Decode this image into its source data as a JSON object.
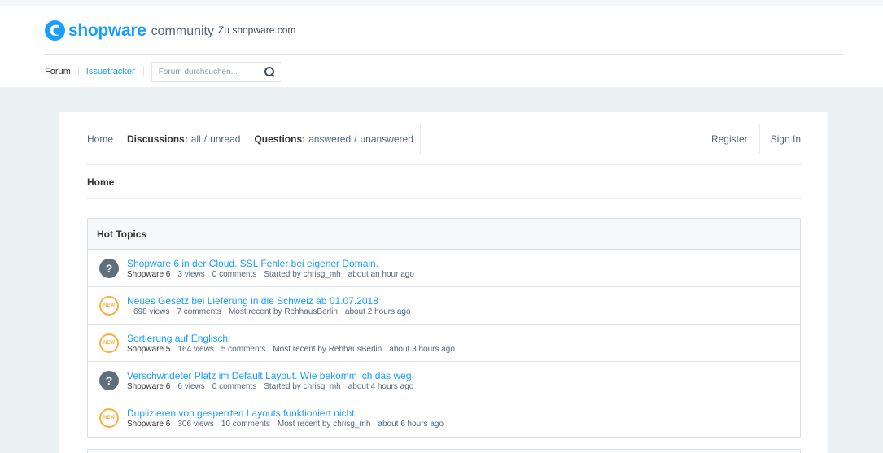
{
  "brand": {
    "logo_word": "shopware",
    "logo_sub": "community",
    "zu_link": "Zu shopware.com",
    "accent": "#189eff"
  },
  "subnav": {
    "forum": "Forum",
    "issuetracker": "Issuetracker",
    "search_placeholder": "Forum durchsuchen..."
  },
  "mainnav": {
    "home": "Home",
    "discussions_label": "Discussions:",
    "discussions_all": "all",
    "discussions_unread": "unread",
    "questions_label": "Questions:",
    "questions_answered": "answered",
    "questions_unanswered": "unanswered",
    "separator": "/",
    "register": "Register",
    "sign_in": "Sign In"
  },
  "breadcrumb": "Home",
  "hot_topics": {
    "heading": "Hot Topics",
    "items": [
      {
        "icon": "question-icon",
        "title": "Shopware 6 in der Cloud. SSL Fehler bei eigener Domain.",
        "category": "Shopware 6",
        "views": "3 views",
        "comments": "0 comments",
        "user_prefix": "Started by",
        "user": "chrisg_mh",
        "time": "about an hour ago"
      },
      {
        "icon": "new-icon",
        "title": "Neues Gesetz bei Lieferung in die Schweiz ab 01.07.2018",
        "category": "",
        "views": "698 views",
        "comments": "7 comments",
        "user_prefix": "Most recent by",
        "user": "RehhausBerlin",
        "time": "about 2 hours ago"
      },
      {
        "icon": "new-icon",
        "title": "Sortierung auf Englisch",
        "category": "Shopware 5",
        "views": "164 views",
        "comments": "5 comments",
        "user_prefix": "Most recent by",
        "user": "RehhausBerlin",
        "time": "about 3 hours ago"
      },
      {
        "icon": "question-icon",
        "title": "Verschwndeter Platz im Default Layout. Wie bekomm ich das weg",
        "category": "Shopware 6",
        "views": "6 views",
        "comments": "0 comments",
        "user_prefix": "Started by",
        "user": "chrisg_mh",
        "time": "about 4 hours ago"
      },
      {
        "icon": "new-icon",
        "title": "Duplizieren von gesperrten Layouts funktioniert nicht",
        "category": "Shopware 6",
        "views": "306 views",
        "comments": "10 comments",
        "user_prefix": "Most recent by",
        "user": "chrisg_mh",
        "time": "about 6 hours ago"
      }
    ],
    "new_badge": "NEW",
    "question_glyph": "?"
  }
}
